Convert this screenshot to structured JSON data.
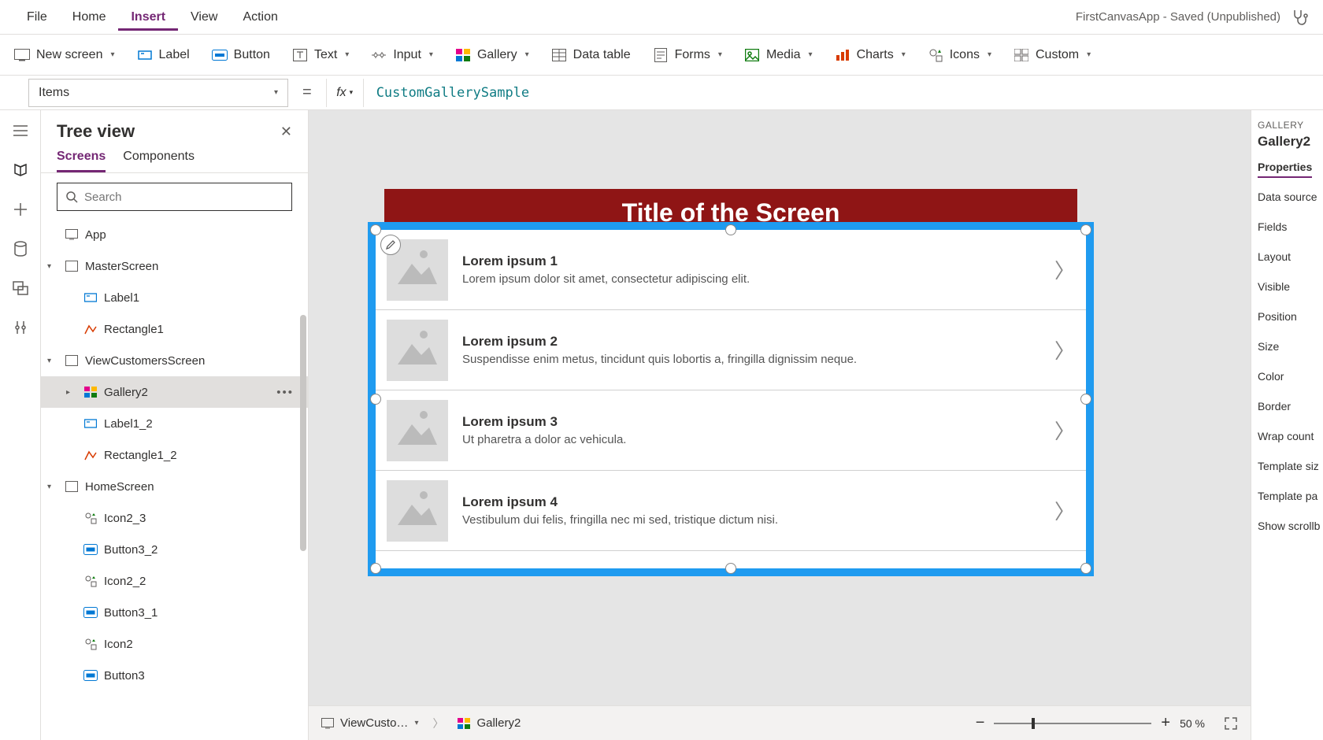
{
  "app_title": "FirstCanvasApp - Saved (Unpublished)",
  "menu": {
    "file": "File",
    "home": "Home",
    "insert": "Insert",
    "view": "View",
    "action": "Action"
  },
  "ribbon": {
    "new_screen": "New screen",
    "label": "Label",
    "button": "Button",
    "text": "Text",
    "input": "Input",
    "gallery": "Gallery",
    "data_table": "Data table",
    "forms": "Forms",
    "media": "Media",
    "charts": "Charts",
    "icons": "Icons",
    "custom": "Custom"
  },
  "formula": {
    "property": "Items",
    "value": "CustomGallerySample"
  },
  "tree": {
    "title": "Tree view",
    "tabs": {
      "screens": "Screens",
      "components": "Components"
    },
    "search_placeholder": "Search",
    "nodes": [
      {
        "label": "App",
        "indent": 0,
        "icon": "app",
        "expand": ""
      },
      {
        "label": "MasterScreen",
        "indent": 0,
        "icon": "screen",
        "expand": "▾"
      },
      {
        "label": "Label1",
        "indent": 1,
        "icon": "label",
        "expand": ""
      },
      {
        "label": "Rectangle1",
        "indent": 1,
        "icon": "rect",
        "expand": ""
      },
      {
        "label": "ViewCustomersScreen",
        "indent": 0,
        "icon": "screen",
        "expand": "▾"
      },
      {
        "label": "Gallery2",
        "indent": 1,
        "icon": "gallery",
        "expand": "▸",
        "selected": true,
        "more": true
      },
      {
        "label": "Label1_2",
        "indent": 1,
        "icon": "label",
        "expand": ""
      },
      {
        "label": "Rectangle1_2",
        "indent": 1,
        "icon": "rect",
        "expand": ""
      },
      {
        "label": "HomeScreen",
        "indent": 0,
        "icon": "screen",
        "expand": "▾"
      },
      {
        "label": "Icon2_3",
        "indent": 1,
        "icon": "icon",
        "expand": ""
      },
      {
        "label": "Button3_2",
        "indent": 1,
        "icon": "button",
        "expand": ""
      },
      {
        "label": "Icon2_2",
        "indent": 1,
        "icon": "icon",
        "expand": ""
      },
      {
        "label": "Button3_1",
        "indent": 1,
        "icon": "button",
        "expand": ""
      },
      {
        "label": "Icon2",
        "indent": 1,
        "icon": "icon",
        "expand": ""
      },
      {
        "label": "Button3",
        "indent": 1,
        "icon": "button",
        "expand": ""
      }
    ]
  },
  "canvas": {
    "screen_title": "Title of the Screen",
    "gallery_items": [
      {
        "title": "Lorem ipsum 1",
        "sub": "Lorem ipsum dolor sit amet, consectetur adipiscing elit."
      },
      {
        "title": "Lorem ipsum 2",
        "sub": "Suspendisse enim metus, tincidunt quis lobortis a, fringilla dignissim neque."
      },
      {
        "title": "Lorem ipsum 3",
        "sub": "Ut pharetra a dolor ac vehicula."
      },
      {
        "title": "Lorem ipsum 4",
        "sub": "Vestibulum dui felis, fringilla nec mi sed, tristique dictum nisi."
      }
    ]
  },
  "breadcrumb": {
    "screen": "ViewCusto…",
    "control": "Gallery2"
  },
  "zoom": {
    "value": "50",
    "unit": "%"
  },
  "props": {
    "caption": "GALLERY",
    "name": "Gallery2",
    "tab": "Properties",
    "rows": [
      "Data source",
      "Fields",
      "Layout",
      "Visible",
      "Position",
      "Size",
      "Color",
      "Border",
      "Wrap count",
      "Template siz",
      "Template pa",
      "Show scrollb"
    ]
  }
}
